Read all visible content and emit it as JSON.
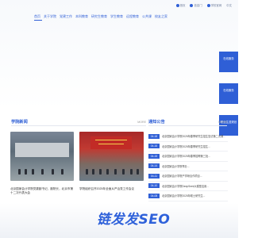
{
  "utility_links": [
    "首页",
    "信息门",
    "学校官网",
    "中文"
  ],
  "nav": [
    "首页",
    "关于学院",
    "党建工作",
    "本科教育",
    "研究生教育",
    "学生教育",
    "远程教育",
    "公共课",
    "校友之家"
  ],
  "side_tabs": [
    "在线服务",
    "在线服务",
    "职业生涯规划"
  ],
  "news": {
    "title": "学院新闻",
    "more": "MORE",
    "items": [
      {
        "caption": "北京国家会计学院党委副书记、副院长，北京市第十二次代表大会"
      },
      {
        "caption": "学院组织召开2025年全面从严治党工作会议"
      }
    ],
    "banner_text": "北京国家会计学院召开2025年全面从严治党工作会议"
  },
  "notices": {
    "title": "通知公告",
    "more": "MORE",
    "items": [
      {
        "date": "04-18",
        "text": "北京国家会计学院2025年春季研究生招生复试第二次调剂..."
      },
      {
        "date": "04-16",
        "text": "北京国家会计学院2025年春季研究生招生..."
      },
      {
        "date": "04-15",
        "text": "北京国家会计学院2025年春季招聘第三批..."
      },
      {
        "date": "04-14",
        "text": "北京国家会计学院举办..."
      },
      {
        "date": "04-11",
        "text": "北京国家会计学院产学研合作项目..."
      },
      {
        "date": "04-10",
        "text": "北京国家会计学院DeepSeek大模型应用..."
      },
      {
        "date": "04-08",
        "text": "北京国家会计学院2025年硕士研究生..."
      },
      {
        "date": "04-07",
        "text": "北京国家会计学院学生党支部..."
      }
    ]
  },
  "watermark": "链发发SEO",
  "colors": {
    "accent": "#2f5fd6",
    "watermark": "#1f56d8"
  }
}
